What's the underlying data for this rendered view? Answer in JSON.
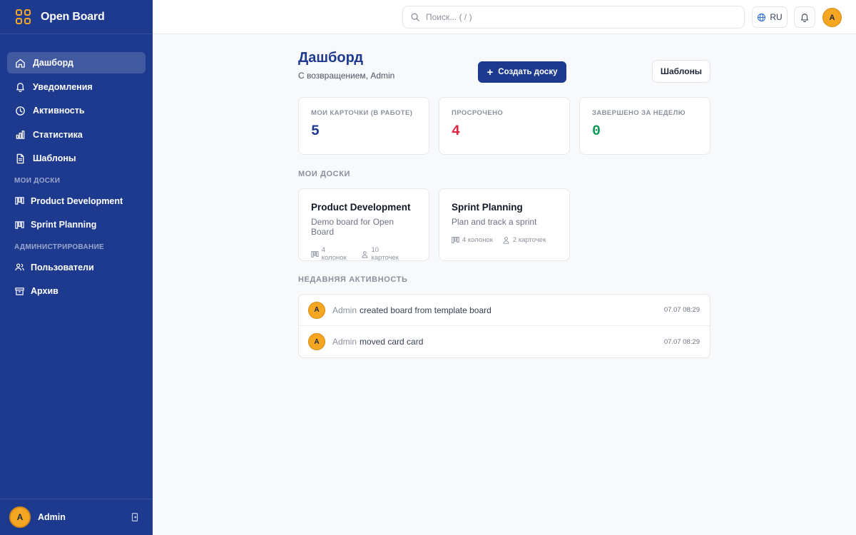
{
  "app": {
    "name": "Open Board"
  },
  "sidebar": {
    "nav": [
      {
        "label": "Дашборд",
        "icon": "home-icon",
        "active": true
      },
      {
        "label": "Уведомления",
        "icon": "bell-icon"
      },
      {
        "label": "Активность",
        "icon": "clock-icon"
      },
      {
        "label": "Статистика",
        "icon": "bar-chart-icon"
      },
      {
        "label": "Шаблоны",
        "icon": "document-icon"
      }
    ],
    "my_boards_title": "МОИ ДОСКИ",
    "boards": [
      {
        "label": "Product Development",
        "icon": "board-icon"
      },
      {
        "label": "Sprint Planning",
        "icon": "board-icon"
      }
    ],
    "admin_title": "АДМИНИСТРИРОВАНИЕ",
    "admin": [
      {
        "label": "Пользователи",
        "icon": "users-icon"
      },
      {
        "label": "Архив",
        "icon": "archive-icon"
      }
    ],
    "footer": {
      "avatar_initial": "A",
      "user_name": "Admin"
    }
  },
  "topbar": {
    "search_placeholder": "Поиск... ( / )",
    "language": "RU",
    "avatar_initial": "A"
  },
  "main": {
    "title": "Дашборд",
    "subtitle": "С возвращением, Admin",
    "create_button": "Создать доску",
    "templates_button": "Шаблоны",
    "stats": [
      {
        "label": "МОИ КАРТОЧКИ (В РАБОТЕ)",
        "value": "5",
        "color": "#1d3a8f"
      },
      {
        "label": "ПРОСРОЧЕНО",
        "value": "4",
        "color": "#dc2644"
      },
      {
        "label": "ЗАВЕРШЕНО ЗА НЕДЕЛЮ",
        "value": "0",
        "color": "#0f9d58"
      }
    ],
    "my_boards_title": "МОИ ДОСКИ",
    "boards": [
      {
        "title": "Product Development",
        "description": "Demo board for Open Board",
        "columns": "4 колонок",
        "cards": "10 карточек"
      },
      {
        "title": "Sprint Planning",
        "description": "Plan and track a sprint",
        "columns": "4 колонок",
        "cards": "2 карточек"
      }
    ],
    "activity_title": "НЕДАВНЯЯ АКТИВНОСТЬ",
    "activity": [
      {
        "avatar_initial": "A",
        "user": "Admin",
        "action": "created board from template board",
        "time": "07.07 08:29"
      },
      {
        "avatar_initial": "A",
        "user": "Admin",
        "action": "moved card card",
        "time": "07.07 08:29"
      }
    ]
  },
  "colors": {
    "sidebar": "#1d3a8f",
    "accent": "#f5a623",
    "primary_button": "#1d3a8f"
  }
}
